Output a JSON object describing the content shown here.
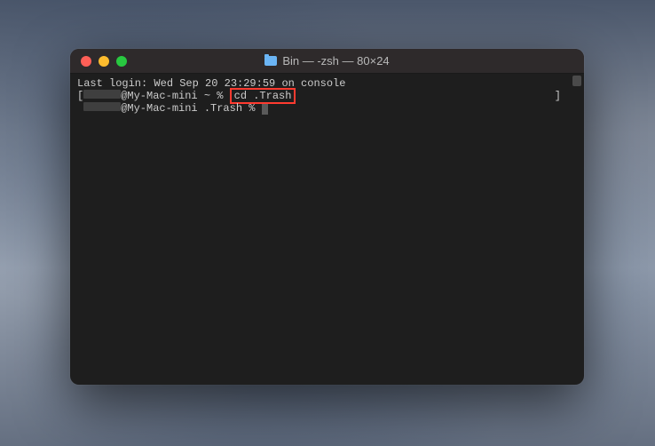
{
  "window": {
    "title": "Bin — -zsh — 80×24"
  },
  "terminal": {
    "line1": "Last login: Wed Sep 20 23:29:59 on console",
    "line2_bracket_left": "[",
    "line2_host": "@My-Mac-mini ~ % ",
    "line2_command": "cd .Trash",
    "line2_bracket_right": "]",
    "line3_host": "@My-Mac-mini .Trash % "
  }
}
